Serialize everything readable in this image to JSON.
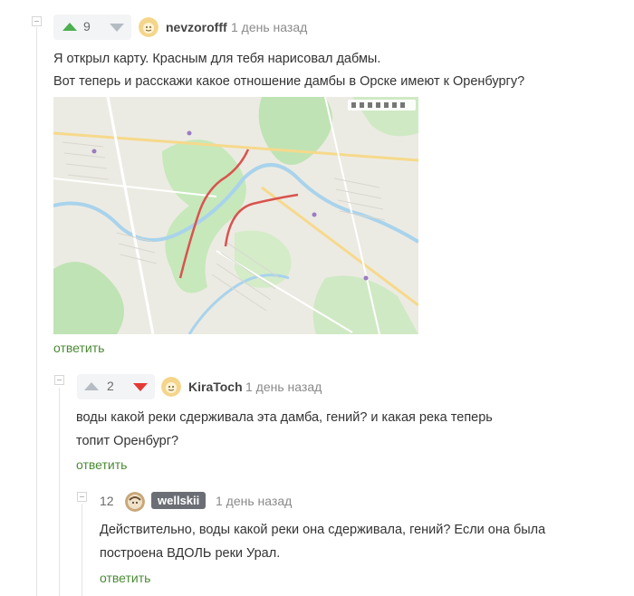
{
  "comment1": {
    "score": "9",
    "username": "nevzorofff",
    "time": "1 день назад",
    "lines": [
      "Я открыл карту. Красным для тебя нарисовал дабмы.",
      "Вот теперь и расскажи какое отношение дамбы в Орске имеют к Оренбургу?"
    ],
    "reply_label": "ответить"
  },
  "comment2": {
    "score": "2",
    "username": "KiraToch",
    "time": "1 день назад",
    "lines": [
      "воды какой реки сдерживала эта дамба, гений? и какая река теперь",
      "топит Оренбург?"
    ],
    "reply_label": "ответить"
  },
  "comment3": {
    "score": "12",
    "username": "wellskii",
    "time": "1 день назад",
    "lines": [
      "Действительно, воды какой реки она сдерживала, гений? Если она была",
      "построена ВДОЛЬ реки Урал."
    ],
    "reply_label": "ответить"
  },
  "colors": {
    "upvote": "#4caf50",
    "downvote_active": "#e53935",
    "reply_link": "#4a8a34",
    "map_river_marks": "#d9534f"
  }
}
